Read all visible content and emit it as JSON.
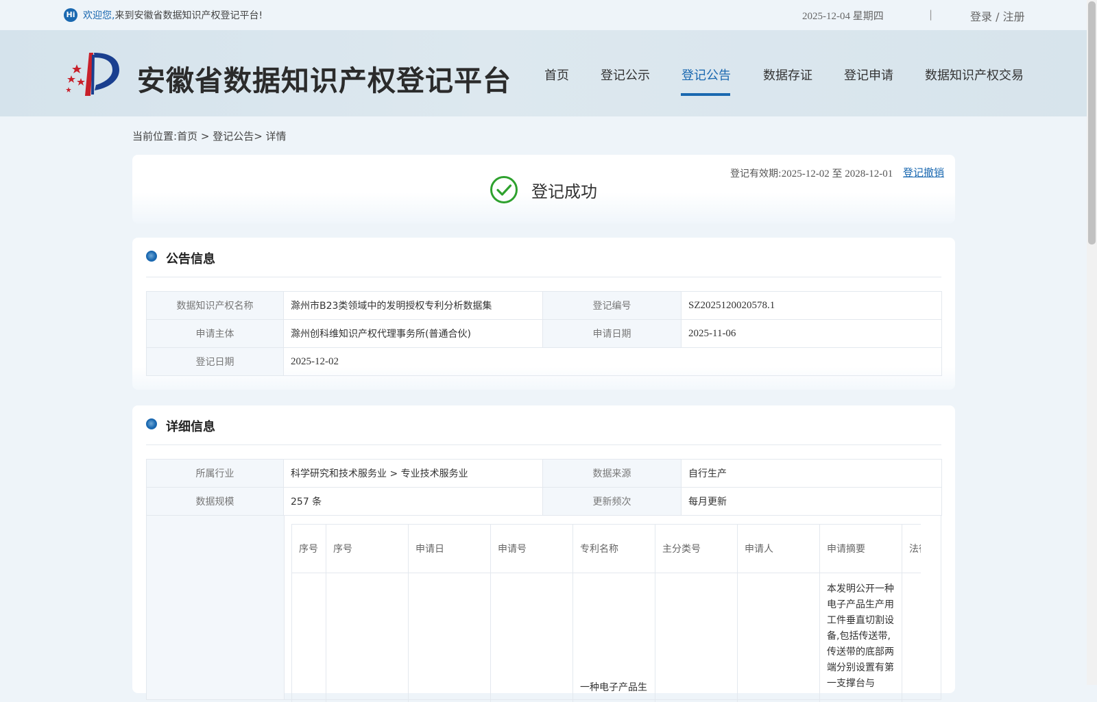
{
  "topbar": {
    "hi_badge": "Hi",
    "welcome_highlight": "欢迎您,",
    "welcome_rest": "来到安徽省数据知识产权登记平台!",
    "date": "2025-12-04 星期四",
    "separator": "|",
    "login_label": "登录 / 注册"
  },
  "header": {
    "site_title": "安徽省数据知识产权登记平台",
    "nav": [
      "首页",
      "登记公示",
      "登记公告",
      "数据存证",
      "登记申请",
      "数据知识产权交易"
    ],
    "active_nav": "登记公告"
  },
  "breadcrumb": {
    "prefix": "当前位置:",
    "home": "首页",
    "sep1": " > ",
    "section": "登记公告",
    "sep2": "> ",
    "current": "详情"
  },
  "status": {
    "text": "登记成功",
    "validity_label": "登记有效期:",
    "validity_dates": "2025-12-02 至 2028-12-01",
    "revoke_label": "登记撤销"
  },
  "announce": {
    "title": "公告信息",
    "rows": [
      {
        "label1": "数据知识产权名称",
        "value1": "滁州市B23类领域中的发明授权专利分析数据集",
        "label2": "登记编号",
        "value2": "SZ2025120020578.1"
      },
      {
        "label1": "申请主体",
        "value1": "滁州创科维知识产权代理事务所(普通合伙)",
        "label2": "申请日期",
        "value2": "2025-11-06"
      }
    ],
    "last_row": {
      "label": "登记日期",
      "value": "2025-12-02"
    }
  },
  "detail": {
    "title": "详细信息",
    "rows": [
      {
        "label1": "所属行业",
        "value1": "科学研究和技术服务业 > 专业技术服务业",
        "label2": "数据来源",
        "value2": "自行生产"
      },
      {
        "label1": "数据规模",
        "value1": "257 条",
        "label2": "更新频次",
        "value2": "每月更新"
      }
    ],
    "sample_table": {
      "headers": [
        "序号",
        "序号",
        "申请日",
        "申请号",
        "专利名称",
        "主分类号",
        "申请人",
        "申请摘要",
        "法律状态"
      ],
      "first_row": {
        "title": "一种电子产品生",
        "summary": "本发明公开一种电子产品生产用工件垂直切割设备,包括传送带,传送带的底部两端分别设置有第一支撑台与"
      }
    }
  },
  "colors": {
    "accent": "#1a68b0",
    "success": "#2ea12e",
    "page_bg": "#eef4f9"
  }
}
